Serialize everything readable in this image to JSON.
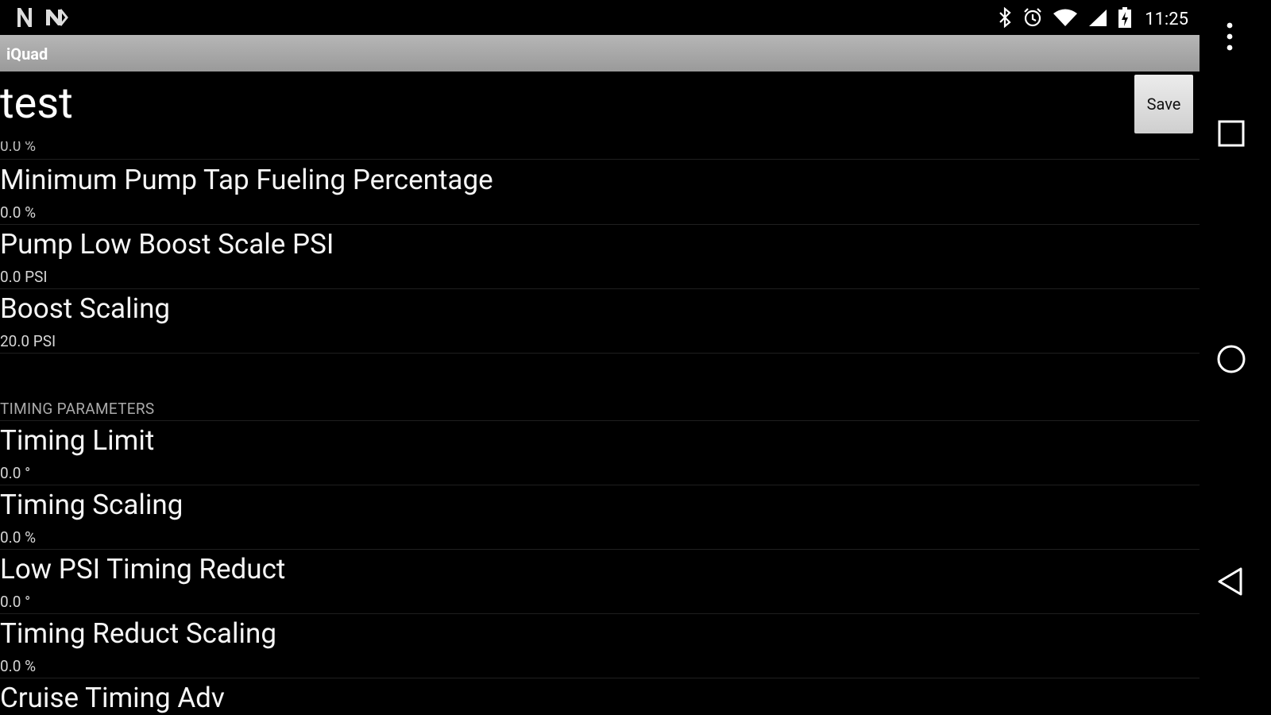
{
  "status_bar": {
    "time": "11:25",
    "icons": [
      "notification-n-icon",
      "notification-n2-icon",
      "bluetooth-icon",
      "alarm-icon",
      "wifi-icon",
      "cell-signal-icon",
      "battery-charging-icon"
    ]
  },
  "app": {
    "title": "iQuad"
  },
  "page": {
    "heading": "test",
    "save_label": "Save",
    "partial_value": "0.0 %"
  },
  "items": [
    {
      "title": "Minimum Pump Tap Fueling Percentage",
      "value": "0.0 %"
    },
    {
      "title": "Pump Low Boost Scale PSI",
      "value": "0.0 PSI"
    },
    {
      "title": "Boost Scaling",
      "value": "20.0 PSI"
    }
  ],
  "section": {
    "label": "TIMING PARAMETERS"
  },
  "timing_items": [
    {
      "title": "Timing Limit",
      "value": "0.0 °"
    },
    {
      "title": "Timing Scaling",
      "value": "0.0 %"
    },
    {
      "title": "Low PSI Timing Reduct",
      "value": "0.0 °"
    },
    {
      "title": "Timing Reduct Scaling",
      "value": "0.0 %"
    },
    {
      "title": "Cruise Timing Adv",
      "value": ""
    }
  ],
  "nav": {
    "buttons": [
      "overflow-menu-icon",
      "recents-icon",
      "home-icon",
      "back-icon"
    ]
  }
}
